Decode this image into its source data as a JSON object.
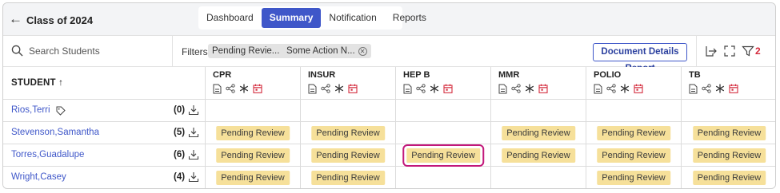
{
  "header": {
    "back_icon": "arrow-left-icon",
    "title": "Class of 2024",
    "tabs": [
      {
        "label": "Dashboard",
        "active": false
      },
      {
        "label": "Summary",
        "active": true
      },
      {
        "label": "Notification",
        "active": false
      },
      {
        "label": "Reports",
        "active": false
      }
    ]
  },
  "toolbar": {
    "search_placeholder": "Search Students",
    "filters_label": "Filters:",
    "chips": [
      "Pending Revie...",
      "Some Action N..."
    ],
    "document_report_label": "Document Details Report",
    "filter_count": "2"
  },
  "table": {
    "student_header": "STUDENT",
    "sort_icon": "arrow-up-icon",
    "columns": [
      "CPR",
      "INSUR",
      "HEP B",
      "MMR",
      "POLIO",
      "TB"
    ],
    "rows": [
      {
        "name": "Rios,Terri",
        "count": "(0)",
        "tag": true,
        "cells": [
          "",
          "",
          "",
          "",
          "",
          ""
        ]
      },
      {
        "name": "Stevenson,Samantha",
        "count": "(5)",
        "tag": false,
        "cells": [
          "Pending Review",
          "Pending Review",
          "",
          "Pending Review",
          "Pending Review",
          "Pending Review"
        ]
      },
      {
        "name": "Torres,Guadalupe",
        "count": "(6)",
        "tag": false,
        "cells": [
          "Pending Review",
          "Pending Review",
          "Pending Review",
          "Pending Review",
          "Pending Review",
          "Pending Review"
        ]
      },
      {
        "name": "Wright,Casey",
        "count": "(4)",
        "tag": false,
        "cells": [
          "Pending Review",
          "Pending Review",
          "",
          "",
          "Pending Review",
          "Pending Review"
        ]
      }
    ],
    "highlighted_cell": {
      "row": 2,
      "col": 2
    }
  },
  "colors": {
    "accent": "#3f57c9",
    "badge": "#f6e09a",
    "highlight": "#c2187a",
    "alert": "#d42a3c"
  }
}
